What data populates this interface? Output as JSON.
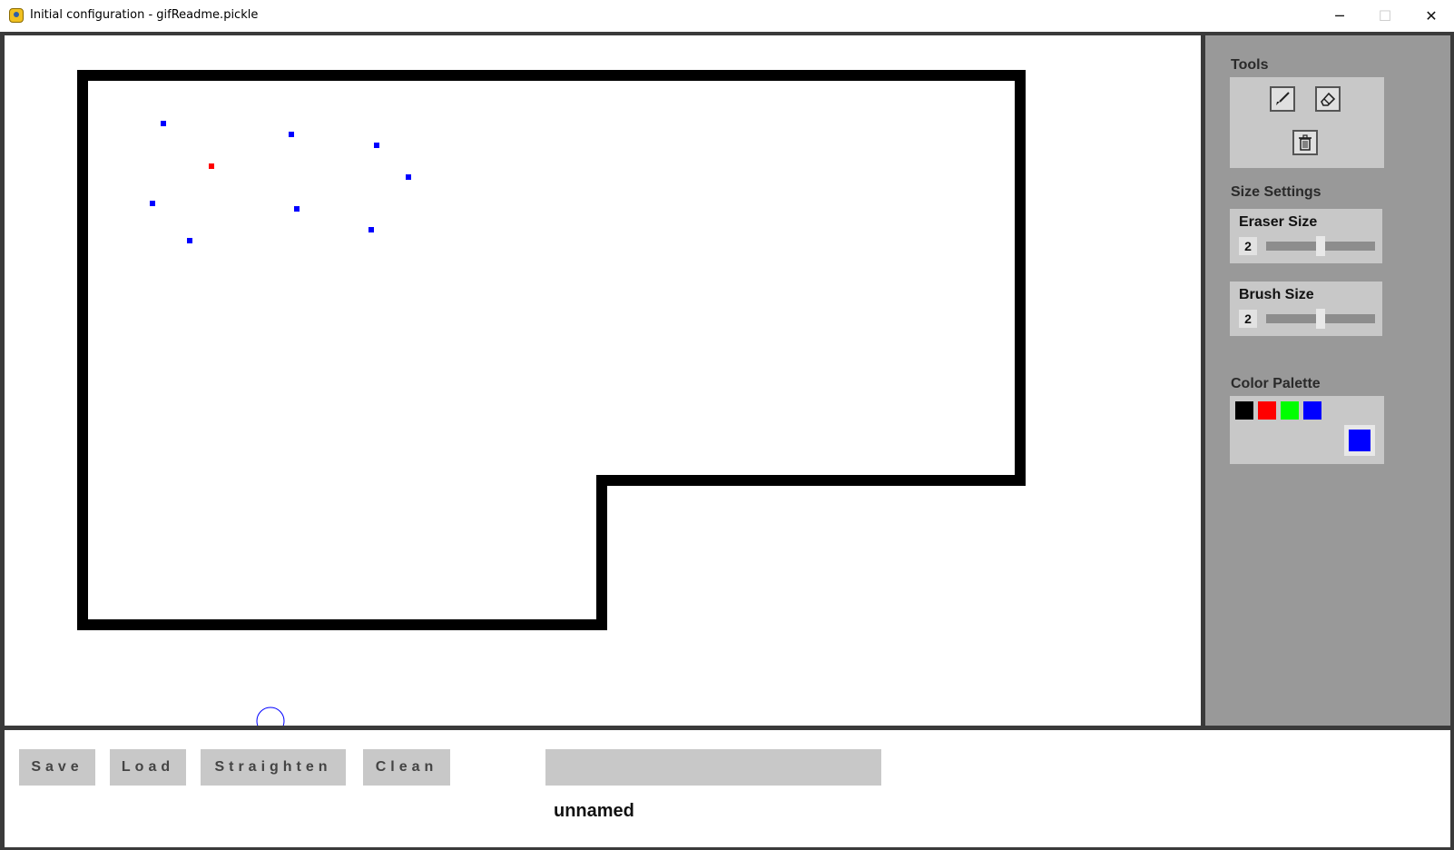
{
  "window": {
    "title": "Initial configuration - gifReadme.pickle",
    "minimize_icon": "minimize-icon",
    "maximize_icon": "maximize-icon",
    "close_icon": "close-icon"
  },
  "sidebar": {
    "tools_title": "Tools",
    "tools": [
      {
        "name": "brush-icon"
      },
      {
        "name": "eraser-icon"
      },
      {
        "name": "trash-icon"
      }
    ],
    "size_title": "Size Settings",
    "eraser": {
      "label": "Eraser Size",
      "value": "2",
      "level": 0.5
    },
    "brush": {
      "label": "Brush Size",
      "value": "2",
      "level": 0.5
    },
    "palette_title": "Color Palette",
    "palette": [
      "#000000",
      "#ff0000",
      "#00ff00",
      "#0000ff"
    ],
    "current_color": "#0000ff"
  },
  "canvas": {
    "wall_color": "#000000",
    "cursor_color": "#0000ff",
    "points": [
      {
        "color": "#0000ff"
      },
      {
        "color": "#0000ff"
      },
      {
        "color": "#0000ff"
      },
      {
        "color": "#ff0000"
      },
      {
        "color": "#0000ff"
      },
      {
        "color": "#0000ff"
      },
      {
        "color": "#0000ff"
      },
      {
        "color": "#0000ff"
      },
      {
        "color": "#0000ff"
      }
    ]
  },
  "bottom": {
    "save_label": "Save",
    "load_label": "Load",
    "straighten_label": "Straighten",
    "clean_label": "Clean",
    "name_input_value": "",
    "filename": "unnamed"
  }
}
